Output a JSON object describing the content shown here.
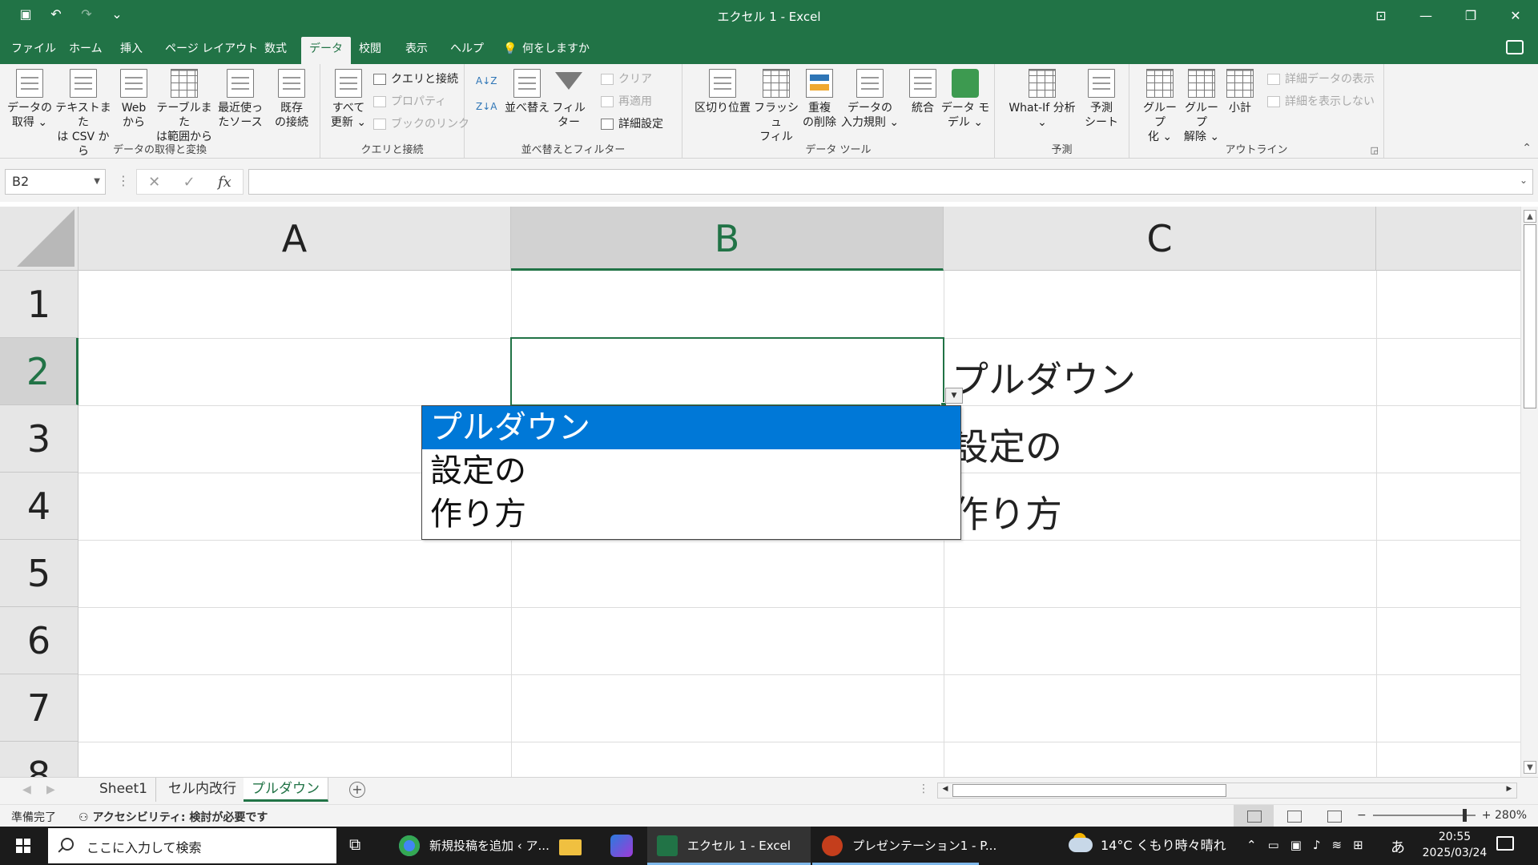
{
  "window": {
    "title": "エクセル 1  -  Excel"
  },
  "tabs": [
    {
      "label": "ファイル"
    },
    {
      "label": "ホーム"
    },
    {
      "label": "挿入"
    },
    {
      "label": "ページ レイアウト"
    },
    {
      "label": "数式"
    },
    {
      "label": "データ"
    },
    {
      "label": "校閲"
    },
    {
      "label": "表示"
    },
    {
      "label": "ヘルプ"
    },
    {
      "label": "何をしますか"
    }
  ],
  "active_tab": "データ",
  "ribbon": {
    "groups": [
      {
        "label": "データの取得と変換"
      },
      {
        "label": "クエリと接続"
      },
      {
        "label": "並べ替えとフィルター"
      },
      {
        "label": "データ ツール"
      },
      {
        "label": "予測"
      },
      {
        "label": "アウトライン"
      }
    ],
    "get_data": {
      "l1": "データの",
      "l2": "取得 ⌄"
    },
    "from_text_csv": {
      "l1": "テキストまた",
      "l2": "は CSV から"
    },
    "from_web": {
      "l1": "Web",
      "l2": "から"
    },
    "from_table": {
      "l1": "テーブルまた",
      "l2": "は範囲から"
    },
    "recent_sources": {
      "l1": "最近使っ",
      "l2": "たソース"
    },
    "existing_connections": {
      "l1": "既存",
      "l2": "の接続"
    },
    "refresh_all": {
      "l1": "すべて",
      "l2": "更新 ⌄"
    },
    "queries_connections": "クエリと接続",
    "properties": "プロパティ",
    "edit_links": "ブックのリンク",
    "sort_az": "A↓Z",
    "sort_za": "Z↓A",
    "sort": "並べ替え",
    "filter": "フィルター",
    "clear": "クリア",
    "reapply": "再適用",
    "advanced": "詳細設定",
    "text_to_columns": "区切り位置",
    "flash_fill": {
      "l1": "フラッシュ",
      "l2": "フィル"
    },
    "remove_duplicates": {
      "l1": "重複",
      "l2": "の削除"
    },
    "data_validation": {
      "l1": "データの",
      "l2": "入力規則 ⌄"
    },
    "consolidate": "統合",
    "data_model": {
      "l1": "データ モ",
      "l2": "デル ⌄"
    },
    "what_if": {
      "l1": "What-If 分析",
      "l2": "⌄"
    },
    "forecast_sheet": {
      "l1": "予測",
      "l2": "シート"
    },
    "group": {
      "l1": "グループ",
      "l2": "化 ⌄"
    },
    "ungroup": {
      "l1": "グループ",
      "l2": "解除 ⌄"
    },
    "subtotal": "小計",
    "show_detail": "詳細データの表示",
    "hide_detail": "詳細を表示しない"
  },
  "formula_bar": {
    "name_box": "B2",
    "fx": "fx",
    "value": ""
  },
  "grid": {
    "columns": [
      "A",
      "B",
      "C"
    ],
    "rows": [
      "1",
      "2",
      "3",
      "4",
      "5",
      "6",
      "7",
      "8"
    ],
    "selected_column": "B",
    "selected_row": "2",
    "cells": {
      "C2": "プルダウン",
      "C3": "設定の",
      "C4": "作り方"
    }
  },
  "dropdown": {
    "options": [
      "プルダウン",
      "設定の",
      "作り方"
    ],
    "highlighted": 0
  },
  "sheets": [
    {
      "name": "Sheet1",
      "active": false
    },
    {
      "name": "セル内改行",
      "active": false
    },
    {
      "name": "プルダウン",
      "active": true
    }
  ],
  "status": {
    "ready": "準備完了",
    "accessibility": "アクセシビリティ: 検討が必要です",
    "zoom": "280%"
  },
  "taskbar": {
    "search_placeholder": "ここに入力して検索",
    "apps": [
      {
        "label": "新規投稿を追加 ‹ ア...",
        "color": "#4285f4"
      },
      {
        "label": "エクセル 1 - Excel",
        "color": "#217346"
      },
      {
        "label": "プレゼンテーション1 - P...",
        "color": "#c43e1c"
      }
    ],
    "weather": "14°C  くもり時々晴れ",
    "ime": "あ",
    "time": "20:55",
    "date": "2025/03/24"
  }
}
